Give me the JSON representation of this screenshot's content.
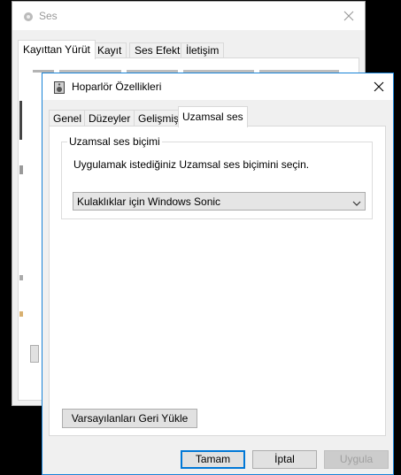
{
  "background_window": {
    "title": "Ses",
    "tabs": [
      {
        "label": "Kayıttan Yürüt",
        "active": true
      },
      {
        "label": "Kayıt",
        "active": false
      },
      {
        "label": "Ses Efekti",
        "active": false
      },
      {
        "label": "İletişim",
        "active": false
      }
    ]
  },
  "dialog": {
    "title": "Hoparlör Özellikleri",
    "tabs": [
      {
        "label": "Genel",
        "active": false
      },
      {
        "label": "Düzeyler",
        "active": false
      },
      {
        "label": "Gelişmiş",
        "active": false
      },
      {
        "label": "Uzamsal ses",
        "active": true
      }
    ],
    "group_title": "Uzamsal ses biçimi",
    "description": "Uygulamak istediğiniz Uzamsal ses biçimini seçin.",
    "format_select": {
      "value": "Kulaklıklar için Windows Sonic"
    },
    "restore_defaults_label": "Varsayılanları Geri Yükle",
    "buttons": {
      "ok": "Tamam",
      "cancel": "İptal",
      "apply": "Uygula"
    }
  },
  "colors": {
    "accent": "#0078d7",
    "window_border": "#1883d7",
    "background": "#000000"
  },
  "icons": {
    "app": "speaker-icon",
    "close": "close-icon",
    "dropdown": "chevron-down-icon"
  }
}
